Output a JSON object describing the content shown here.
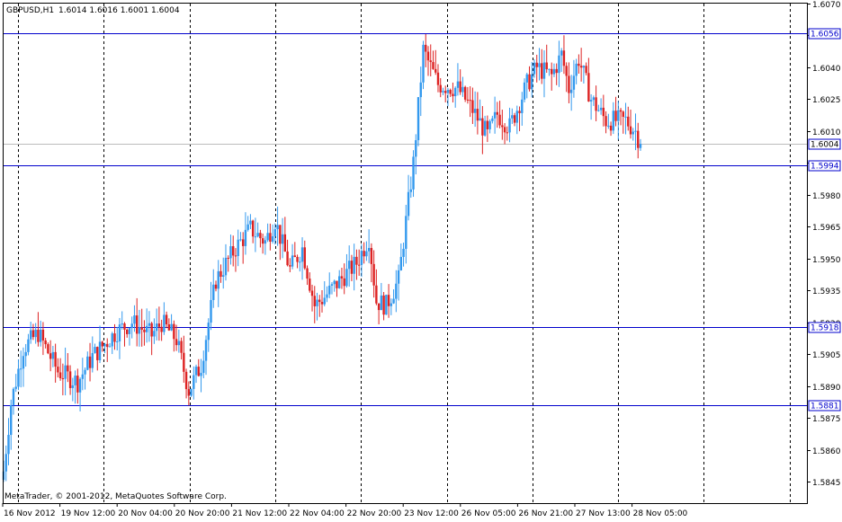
{
  "header": {
    "symbol": "GBPUSD,H1",
    "ohlc": "1.6014 1.6016 1.6001 1.6004"
  },
  "footer": {
    "copyright": "MetaTrader, © 2001-2012, MetaQuotes Software Corp."
  },
  "colors": {
    "bull": "#3399ee",
    "bear": "#dd2222",
    "hline": "#0000cc",
    "bid": "#bbbbbb",
    "grid": "#000000"
  },
  "chart_data": {
    "type": "candlestick",
    "symbol": "GBPUSD",
    "timeframe": "H1",
    "ylim": [
      1.5835,
      1.607
    ],
    "y_ticks": [
      "1.6070",
      "1.6055",
      "1.6040",
      "1.6025",
      "1.6010",
      "1.5995",
      "1.5980",
      "1.5965",
      "1.5950",
      "1.5935",
      "1.5920",
      "1.5905",
      "1.5890",
      "1.5875",
      "1.5860",
      "1.5845"
    ],
    "x_labels": [
      "16 Nov 2012",
      "19 Nov 12:00",
      "20 Nov 04:00",
      "20 Nov 20:00",
      "21 Nov 12:00",
      "22 Nov 04:00",
      "22 Nov 20:00",
      "23 Nov 12:00",
      "26 Nov 05:00",
      "26 Nov 21:00",
      "27 Nov 13:00",
      "28 Nov 05:00"
    ],
    "horizontal_lines": [
      {
        "value": 1.6056,
        "label": "1.6056"
      },
      {
        "value": 1.5994,
        "label": "1.5994"
      },
      {
        "value": 1.5918,
        "label": "1.5918"
      },
      {
        "value": 1.5881,
        "label": "1.5881"
      }
    ],
    "current_price": {
      "value": 1.6004,
      "label": "1.6004"
    },
    "anchors": [
      [
        0,
        1.585
      ],
      [
        3,
        1.5882
      ],
      [
        8,
        1.5908
      ],
      [
        14,
        1.5915
      ],
      [
        22,
        1.5897
      ],
      [
        30,
        1.5892
      ],
      [
        36,
        1.5904
      ],
      [
        46,
        1.5916
      ],
      [
        52,
        1.592
      ],
      [
        60,
        1.5914
      ],
      [
        64,
        1.592
      ],
      [
        70,
        1.5912
      ],
      [
        75,
        1.5888
      ],
      [
        80,
        1.59
      ],
      [
        86,
        1.594
      ],
      [
        94,
        1.5955
      ],
      [
        100,
        1.5964
      ],
      [
        106,
        1.5958
      ],
      [
        110,
        1.5968
      ],
      [
        116,
        1.5945
      ],
      [
        121,
        1.5955
      ],
      [
        126,
        1.5928
      ],
      [
        130,
        1.5932
      ],
      [
        138,
        1.5942
      ],
      [
        143,
        1.5948
      ],
      [
        148,
        1.596
      ],
      [
        151,
        1.593
      ],
      [
        155,
        1.5928
      ],
      [
        160,
        1.594
      ],
      [
        166,
        1.5995
      ],
      [
        170,
        1.6048
      ],
      [
        176,
        1.6032
      ],
      [
        184,
        1.603
      ],
      [
        190,
        1.602
      ],
      [
        196,
        1.6008
      ],
      [
        200,
        1.6018
      ],
      [
        205,
        1.6012
      ],
      [
        212,
        1.6032
      ],
      [
        216,
        1.604
      ],
      [
        222,
        1.6036
      ],
      [
        226,
        1.6046
      ],
      [
        229,
        1.603
      ],
      [
        233,
        1.6044
      ],
      [
        238,
        1.6025
      ],
      [
        244,
        1.6015
      ],
      [
        252,
        1.6015
      ],
      [
        256,
        1.601
      ],
      [
        258,
        1.6004
      ]
    ]
  }
}
